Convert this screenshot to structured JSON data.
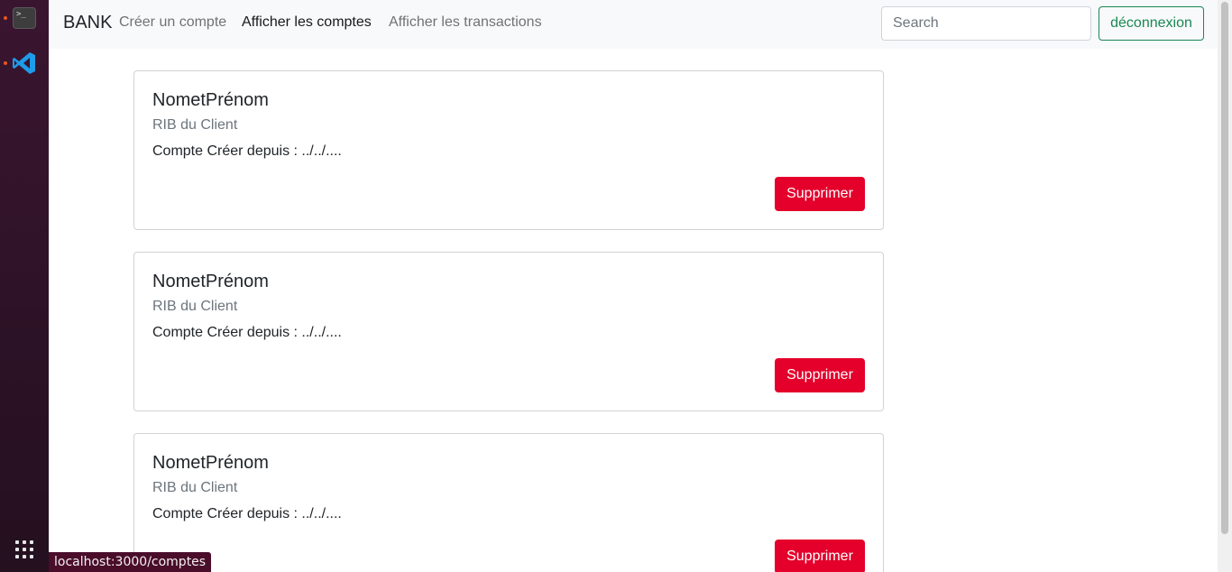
{
  "dock": {
    "items": [
      {
        "name": "terminal-icon",
        "glyph": ">_"
      },
      {
        "name": "vscode-icon"
      }
    ]
  },
  "navbar": {
    "brand": "BANK",
    "links": [
      "Créer un compte",
      "Afficher les comptes",
      "Afficher les transactions"
    ],
    "search_placeholder": "Search",
    "logout_label": "déconnexion"
  },
  "accounts": [
    {
      "title": "NometPrénom",
      "subtitle": "RIB du Client",
      "text": "Compte Créer depuis : ../../....",
      "delete_label": "Supprimer"
    },
    {
      "title": "NometPrénom",
      "subtitle": "RIB du Client",
      "text": "Compte Créer depuis : ../../....",
      "delete_label": "Supprimer"
    },
    {
      "title": "NometPrénom",
      "subtitle": "RIB du Client",
      "text": "Compte Créer depuis : ../../....",
      "delete_label": "Supprimer"
    }
  ],
  "status_url": "localhost:3000/comptes",
  "colors": {
    "delete_button": "#e4002b",
    "logout_border": "#198754",
    "navbar_bg": "#f8f9fa"
  }
}
